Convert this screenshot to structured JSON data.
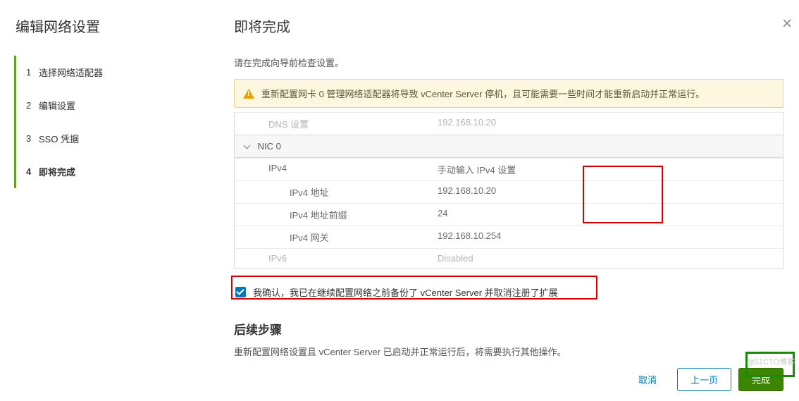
{
  "sidebar": {
    "title": "编辑网络设置",
    "steps": [
      {
        "num": "1",
        "label": "选择网络适配器"
      },
      {
        "num": "2",
        "label": "编辑设置"
      },
      {
        "num": "3",
        "label": "SSO 凭据"
      },
      {
        "num": "4",
        "label": "即将完成"
      }
    ]
  },
  "main": {
    "title": "即将完成",
    "subtitle": "请在完成向导前检查设置。",
    "warning": "重新配置网卡 0 管理网络适配器将导致 vCenter Server 停机，且可能需要一些时间才能重新启动并正常运行。",
    "dns_row": {
      "label": "DNS 设置",
      "value": "192.168.10.20"
    },
    "nic_header": "NIC 0",
    "ipv4": {
      "label": "IPv4",
      "mode": "手动输入 IPv4 设置",
      "addr_label": "IPv4 地址",
      "addr_value": "192.168.10.20",
      "prefix_label": "IPv4 地址前缀",
      "prefix_value": "24",
      "gw_label": "IPv4 网关",
      "gw_value": "192.168.10.254"
    },
    "ipv6": {
      "label": "IPv6",
      "value": "Disabled"
    },
    "confirm": "我确认，我已在继续配置网络之前备份了 vCenter Server 并取消注册了扩展",
    "next_title": "后续步骤",
    "next_desc": "重新配置网络设置且 vCenter Server 已启动并正常运行后，将需要执行其他操作。"
  },
  "footer": {
    "cancel": "取消",
    "prev": "上一页",
    "finish": "完成"
  },
  "watermark": "@51CTO博客"
}
